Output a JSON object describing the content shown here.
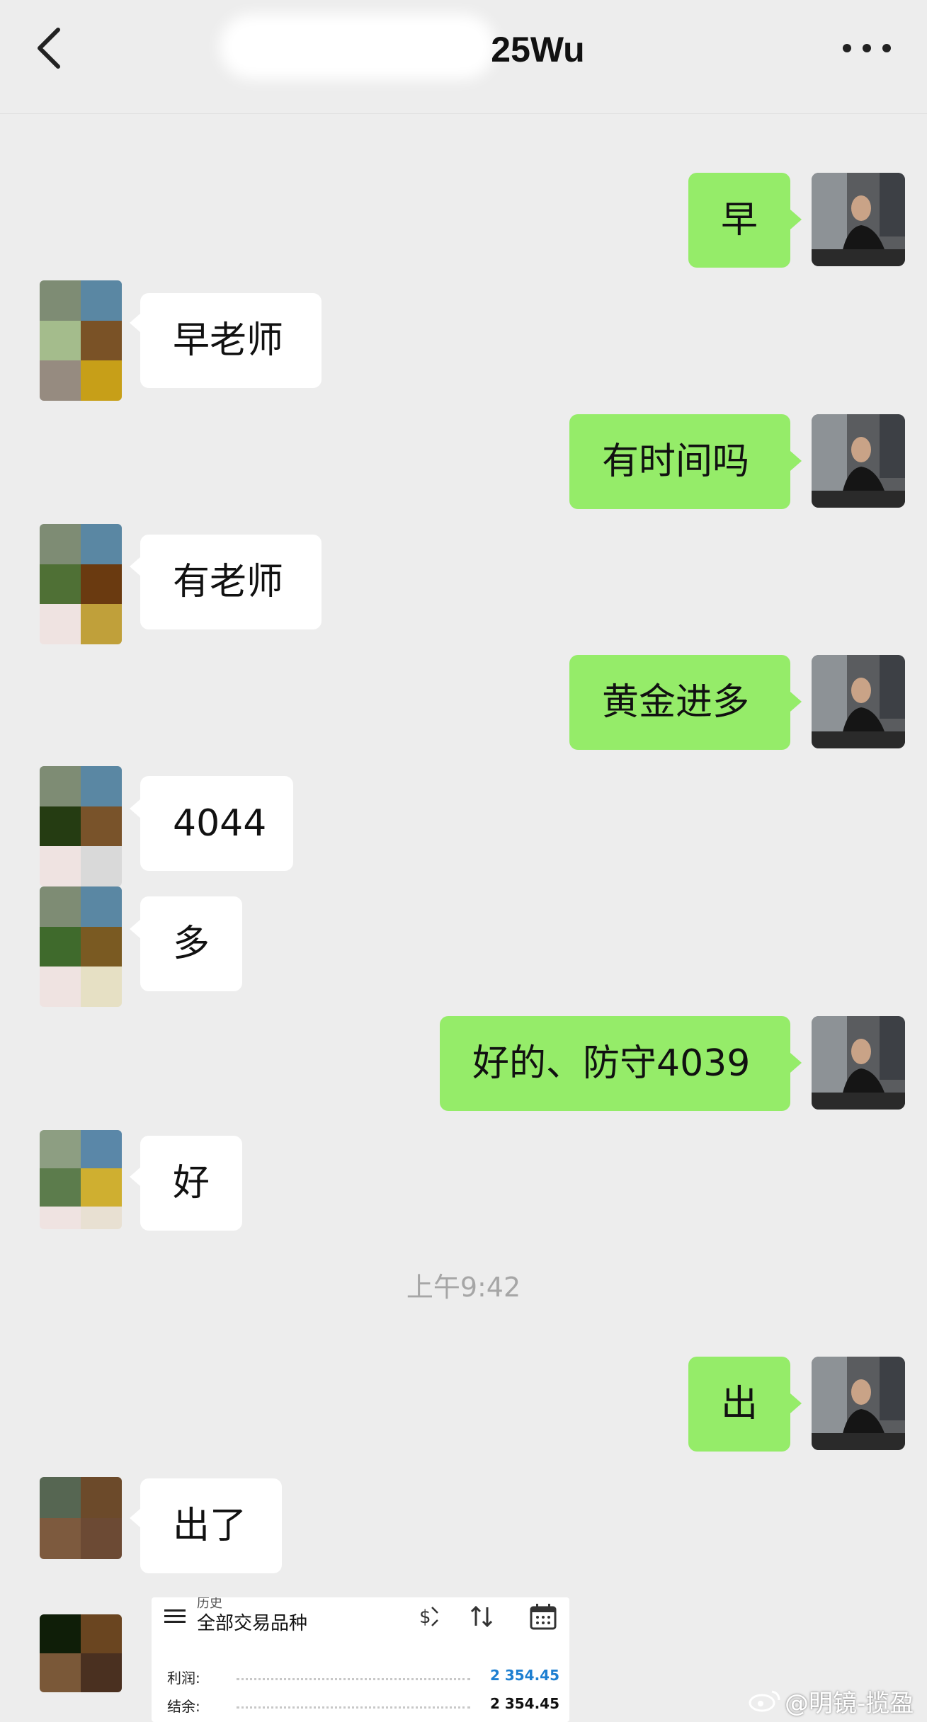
{
  "header": {
    "title": "25Wu"
  },
  "messages": [
    {
      "side": "right",
      "text": "早"
    },
    {
      "side": "left",
      "text": "早老师"
    },
    {
      "side": "right",
      "text": "有时间吗"
    },
    {
      "side": "left",
      "text": "有老师"
    },
    {
      "side": "right",
      "text": "黄金进多"
    },
    {
      "side": "left",
      "text": "4044"
    },
    {
      "side": "left",
      "text": "多"
    },
    {
      "side": "right",
      "text": "好的、防守4039"
    },
    {
      "side": "left",
      "text": "好"
    },
    {
      "side": "right",
      "text": "出"
    },
    {
      "side": "left",
      "text": "出了"
    }
  ],
  "timestamp": "上午9:42",
  "trade_card": {
    "history_label": "历史",
    "subtitle": "全部交易品种",
    "profit_label": "利润:",
    "profit_value": "2 354.45",
    "balance_label": "结余:",
    "balance_value": "2 354.45",
    "profit_color": "#1d7fd1"
  },
  "watermark": "@明镜-揽盈",
  "colors": {
    "sent_bubble": "#95ec69",
    "received_bubble": "#ffffff",
    "background": "#ededed"
  }
}
